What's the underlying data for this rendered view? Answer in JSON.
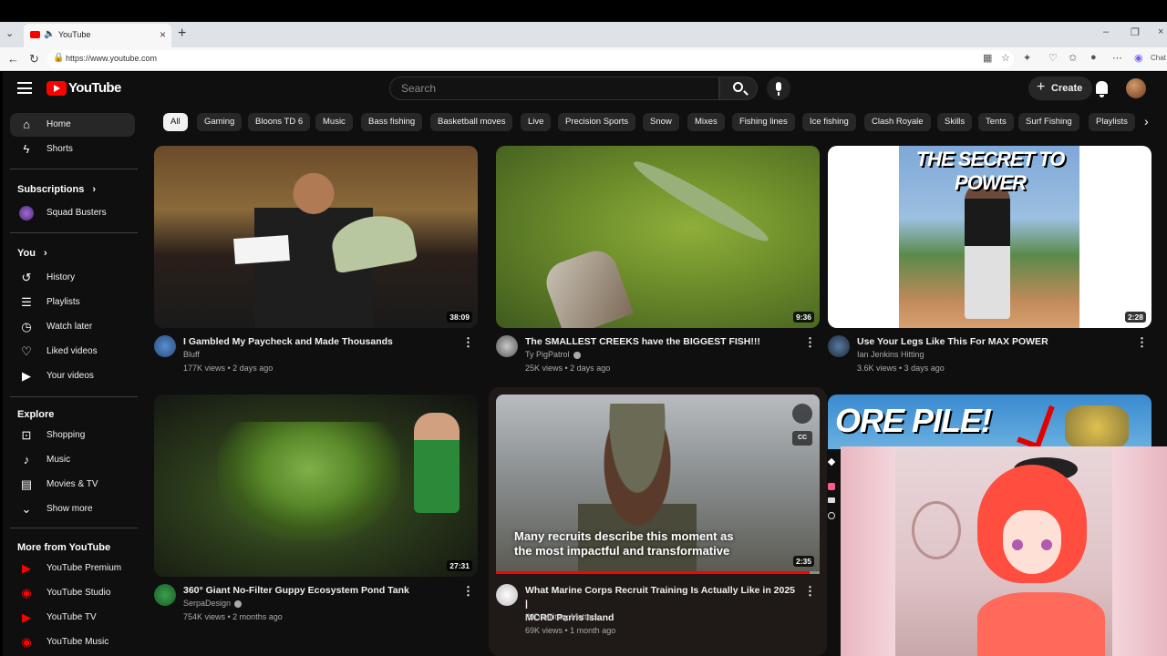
{
  "browser": {
    "tab_title": "YouTube",
    "url": "https://www.youtube.com",
    "ext_label": "Chat"
  },
  "header": {
    "logo_text": "YouTube",
    "search_placeholder": "Search",
    "create_label": "Create"
  },
  "sidebar": {
    "primary": [
      {
        "label": "Home",
        "icon": "home-icon",
        "glyph": "⌂"
      },
      {
        "label": "Shorts",
        "icon": "shorts-icon",
        "glyph": "⚡"
      }
    ],
    "subscriptions_head": "Subscriptions",
    "subscriptions": [
      {
        "label": "Squad Busters"
      }
    ],
    "you_head": "You",
    "you": [
      {
        "label": "History",
        "icon": "history-icon",
        "glyph": "↺"
      },
      {
        "label": "Playlists",
        "icon": "playlists-icon",
        "glyph": "☰"
      },
      {
        "label": "Watch later",
        "icon": "watch-later-icon",
        "glyph": "◷"
      },
      {
        "label": "Liked videos",
        "icon": "like-icon",
        "glyph": "👍"
      },
      {
        "label": "Your videos",
        "icon": "your-videos-icon",
        "glyph": "▶"
      }
    ],
    "explore_head": "Explore",
    "explore": [
      {
        "label": "Shopping",
        "icon": "shopping-icon",
        "glyph": "🛍"
      },
      {
        "label": "Music",
        "icon": "music-icon",
        "glyph": "♪"
      },
      {
        "label": "Movies & TV",
        "icon": "movies-icon",
        "glyph": "🎞"
      },
      {
        "label": "Show more",
        "icon": "chevron-down-icon",
        "glyph": "⌄"
      }
    ],
    "more_head": "More from YouTube",
    "more": [
      {
        "label": "YouTube Premium"
      },
      {
        "label": "YouTube Studio"
      },
      {
        "label": "YouTube TV"
      },
      {
        "label": "YouTube Music"
      }
    ]
  },
  "chips": [
    "All",
    "Gaming",
    "Bloons TD 6",
    "Music",
    "Bass fishing",
    "Basketball moves",
    "Live",
    "Precision Sports",
    "Snow",
    "Mixes",
    "Fishing lines",
    "Ice fishing",
    "Clash Royale",
    "Skills",
    "Tents",
    "Surf Fishing",
    "Playlists"
  ],
  "videos": [
    {
      "title": "I Gambled My Paycheck and Made Thousands",
      "channel": "Bluff",
      "meta": "177K views • 2 days ago",
      "duration": "38:09"
    },
    {
      "title": "The SMALLEST CREEKS have the BIGGEST FISH!!!",
      "channel": "Ty PigPatrol",
      "meta": "25K views • 2 days ago",
      "duration": "9:36"
    },
    {
      "title": "Use Your Legs Like This For MAX POWER",
      "channel": "Ian Jenkins Hitting",
      "meta": "3.6K views • 3 days ago",
      "duration": "2:28",
      "thumb_text": "THE SECRET TO POWER"
    },
    {
      "title": "360° Giant No-Filter Guppy Ecosystem Pond Tank",
      "channel": "SerpaDesign",
      "meta": "754K views • 2 months ago",
      "duration": "27:31"
    },
    {
      "title_line1": "What Marine Corps Recruit Training Is Actually Like in 2025 |",
      "title_line2": "MCRD Parris Island",
      "channel": "IMD Military Matters",
      "meta": "69K views • 1 month ago",
      "duration": "2:35",
      "caption_line1": "Many recruits describe this moment as",
      "caption_line2": "the most impactful and transformative",
      "cc": "CC",
      "progress": 0.97
    },
    {
      "thumb_text": "ORE PILE!"
    }
  ]
}
